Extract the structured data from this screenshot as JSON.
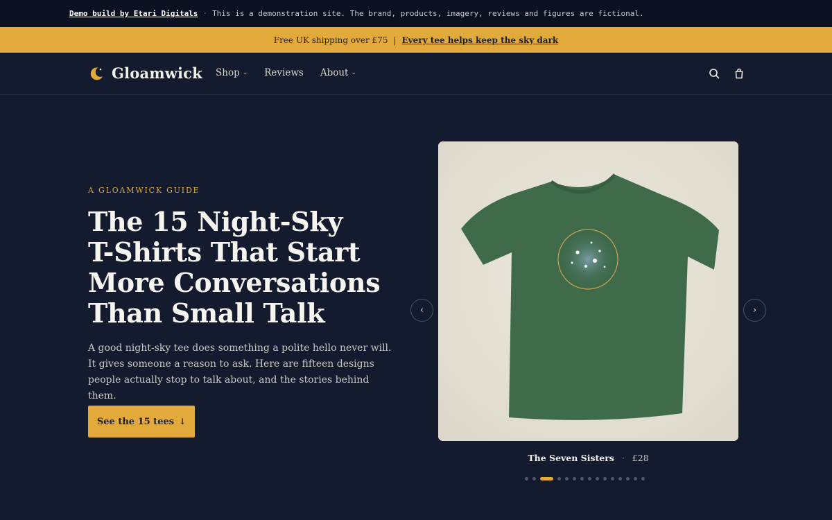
{
  "demo_bar": {
    "link": "Demo build by Etari Digitals",
    "separator": "·",
    "notice": "This is a demonstration site. The brand, products, imagery, reviews and figures are fictional."
  },
  "shipping_bar": {
    "text": "Free UK shipping over £75",
    "separator": "|",
    "link": "Every tee helps keep the sky dark"
  },
  "nav": {
    "brand": "Gloamwick",
    "links": [
      {
        "label": "Shop",
        "has_dropdown": true
      },
      {
        "label": "Reviews",
        "has_dropdown": false
      },
      {
        "label": "About",
        "has_dropdown": true
      }
    ],
    "icons": [
      "search-icon",
      "shopping-bag-icon"
    ]
  },
  "hero": {
    "kicker": "A GLOAMWICK GUIDE",
    "headline_lines": [
      "The 15 Night-Sky",
      "T-Shirts That Start",
      "More Conversations",
      "Than Small Talk"
    ],
    "lede": "A good night-sky tee does something a polite hello never will. It gives someone a reason to ask. Here are fifteen designs people actually stop to talk about, and the stories behind them.",
    "cta_label": "See the 15 tees",
    "cta_icon": "arrow-down-icon"
  },
  "carousel": {
    "product_name": "The Seven Sisters",
    "separator": "·",
    "price": "£28",
    "prev_icon": "chevron-left-icon",
    "next_icon": "chevron-right-icon",
    "total_slides": 15,
    "active_slide": 3
  },
  "colors": {
    "background": "#141b2e",
    "accent": "#e2a93b",
    "demo_bar": "#0b1120",
    "tee_green": "#3f6b4a"
  }
}
